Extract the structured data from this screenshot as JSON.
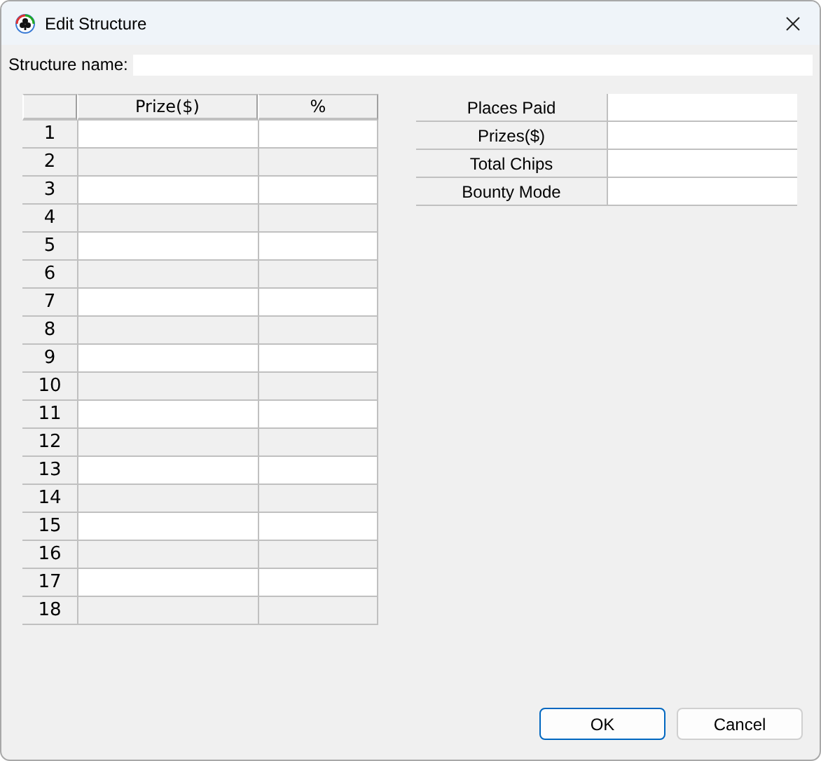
{
  "window": {
    "title": "Edit Structure"
  },
  "structure_name": {
    "label": "Structure name:"
  },
  "prize_table": {
    "columns": [
      "Prize($)",
      "%"
    ],
    "rows": [
      "1",
      "2",
      "3",
      "4",
      "5",
      "6",
      "7",
      "8",
      "9",
      "10",
      "11",
      "12",
      "13",
      "14",
      "15",
      "16",
      "17",
      "18"
    ]
  },
  "settings_table": {
    "rows": [
      "Places Paid",
      "Prizes($)",
      "Total Chips",
      "Bounty Mode"
    ]
  },
  "buttons": [
    {
      "label": "OK",
      "default": true
    },
    {
      "label": "Cancel",
      "default": false
    }
  ]
}
